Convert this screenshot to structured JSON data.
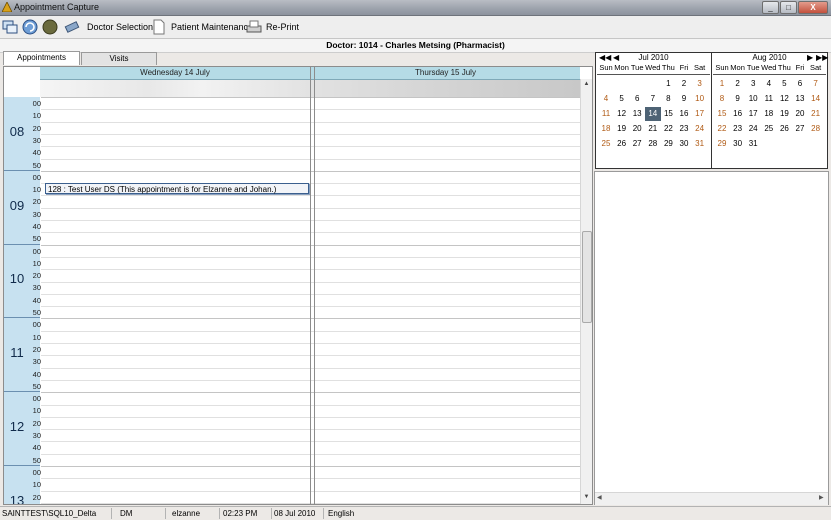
{
  "window": {
    "title": "Appointment Capture",
    "min": "_",
    "max": "□",
    "close": "X"
  },
  "toolbar": {
    "doctor_selection": "Doctor Selection",
    "patient_maintenance": "Patient Maintenance",
    "reprint": "Re-Print"
  },
  "doctor_header": "Doctor: 1014 - Charles Metsing (Pharmacist)",
  "tabs": [
    {
      "label": "Appointments",
      "active": true
    },
    {
      "label": "Visits",
      "active": false
    }
  ],
  "schedule": {
    "days": [
      "Wednesday 14 July",
      "Thursday 15 July"
    ],
    "hours": [
      "08",
      "09",
      "10",
      "11",
      "12",
      "13"
    ],
    "minutes": [
      "00",
      "10",
      "20",
      "30",
      "40",
      "50"
    ],
    "appointment": "128 : Test User DS (This appointment is for Elzanne and Johan.)"
  },
  "calendars": [
    {
      "month": "Jul 2010",
      "dow": [
        "Sun",
        "Mon",
        "Tue",
        "Wed",
        "Thu",
        "Fri",
        "Sat"
      ],
      "weeks": [
        [
          "",
          "",
          "",
          "",
          "1",
          "2",
          "3"
        ],
        [
          "4",
          "5",
          "6",
          "7",
          "8",
          "9",
          "10"
        ],
        [
          "11",
          "12",
          "13",
          "14",
          "15",
          "16",
          "17"
        ],
        [
          "18",
          "19",
          "20",
          "21",
          "22",
          "23",
          "24"
        ],
        [
          "25",
          "26",
          "27",
          "28",
          "29",
          "30",
          "31"
        ]
      ],
      "selected": "14"
    },
    {
      "month": "Aug 2010",
      "dow": [
        "Sun",
        "Mon",
        "Tue",
        "Wed",
        "Thu",
        "Fri",
        "Sat"
      ],
      "weeks": [
        [
          "1",
          "2",
          "3",
          "4",
          "5",
          "6",
          "7"
        ],
        [
          "8",
          "9",
          "10",
          "11",
          "12",
          "13",
          "14"
        ],
        [
          "15",
          "16",
          "17",
          "18",
          "19",
          "20",
          "21"
        ],
        [
          "22",
          "23",
          "24",
          "25",
          "26",
          "27",
          "28"
        ],
        [
          "29",
          "30",
          "31",
          "",
          "",
          "",
          ""
        ]
      ],
      "selected": ""
    }
  ],
  "status_bar": [
    "SAINTTEST\\SQL10_Delta",
    "DM",
    "elzanne",
    "02:23 PM",
    "08 Jul 2010",
    "English"
  ],
  "colors": {
    "header_blue": "#b5dbe6",
    "time_blue": "#c7e1f0",
    "weekend": "#b05a14",
    "selected_day": "#4e6375"
  }
}
